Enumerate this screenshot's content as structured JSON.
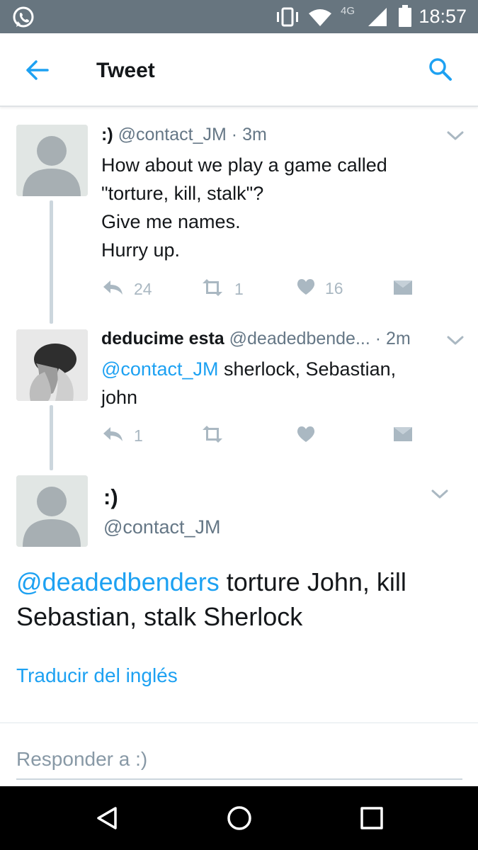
{
  "status_bar": {
    "time": "18:57",
    "network": "4G",
    "icons": [
      "whatsapp-icon",
      "vibrate-icon",
      "wifi-icon",
      "signal-icon",
      "battery-icon"
    ]
  },
  "app_bar": {
    "title": "Tweet",
    "back_icon": "arrow-back-icon",
    "search_icon": "search-icon"
  },
  "thread": [
    {
      "name": ":)",
      "handle": "@contact_JM",
      "separator": "·",
      "time": "3m",
      "lines": [
        "How about we play a game called",
        "\"torture, kill, stalk\"?",
        "Give me names.",
        "Hurry up."
      ],
      "actions": {
        "reply_count": "24",
        "retweet_count": "1",
        "like_count": "16"
      }
    },
    {
      "name": "deducime esta",
      "handle": "@deadedbende...",
      "separator": "·",
      "time": "2m",
      "mention": "@contact_JM",
      "line1_rest": " sherlock, Sebastian,",
      "line2": "john",
      "actions": {
        "reply_count": "1"
      }
    }
  ],
  "main_tweet": {
    "name": ":)",
    "handle": "@contact_JM",
    "mention": "@deadedbenders",
    "text_rest": " torture John, kill Sebastian, stalk Sherlock",
    "translate_link": "Traducir del inglés"
  },
  "reply": {
    "placeholder": "Responder a :)"
  },
  "colors": {
    "accent": "#1da1f2",
    "status_bar": "#67757f",
    "muted": "#657786",
    "action_gray": "#aab8c2"
  }
}
